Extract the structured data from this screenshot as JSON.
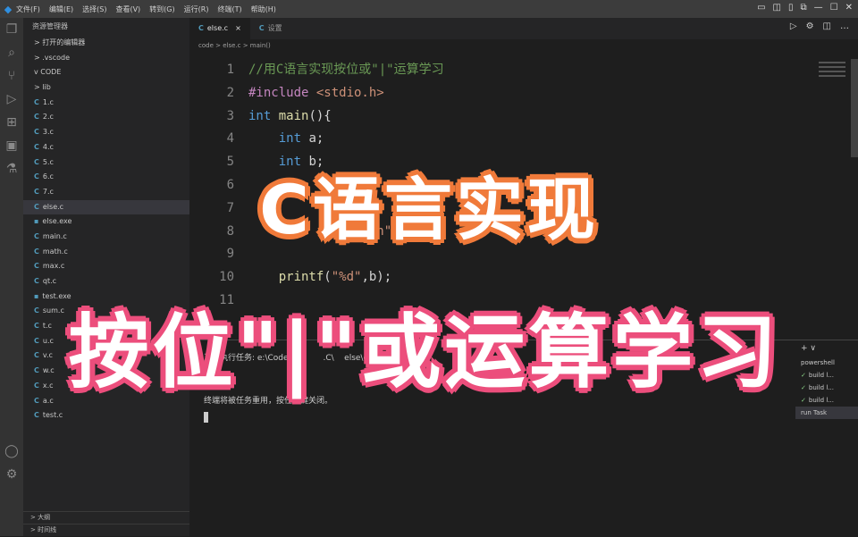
{
  "menu": [
    "文件(F)",
    "编辑(E)",
    "选择(S)",
    "查看(V)",
    "转到(G)",
    "运行(R)",
    "终端(T)",
    "帮助(H)"
  ],
  "window_controls": [
    "▭",
    "◫",
    "▯",
    "⧉",
    "—",
    "☐",
    "✕"
  ],
  "activity_icons": [
    "files-icon",
    "search-icon",
    "source-control-icon",
    "run-debug-icon",
    "extensions-icon",
    "remote-icon",
    "test-icon",
    "account-icon",
    "settings-icon"
  ],
  "sidebar": {
    "header": "资源管理器",
    "files": [
      {
        "label": "> 打开的编辑器",
        "type": "folder"
      },
      {
        "label": "> .vscode",
        "type": "folder"
      },
      {
        "label": "v CODE",
        "type": "folder"
      },
      {
        "label": "> lib",
        "type": "folder"
      },
      {
        "label": "1.c",
        "type": "c"
      },
      {
        "label": "2.c",
        "type": "c"
      },
      {
        "label": "3.c",
        "type": "c"
      },
      {
        "label": "4.c",
        "type": "c"
      },
      {
        "label": "5.c",
        "type": "c"
      },
      {
        "label": "6.c",
        "type": "c"
      },
      {
        "label": "7.c",
        "type": "c"
      },
      {
        "label": "else.c",
        "type": "c",
        "selected": true
      },
      {
        "label": "else.exe",
        "type": "exe"
      },
      {
        "label": "main.c",
        "type": "c"
      },
      {
        "label": "math.c",
        "type": "c"
      },
      {
        "label": "max.c",
        "type": "c"
      },
      {
        "label": "qt.c",
        "type": "c"
      },
      {
        "label": "test.exe",
        "type": "exe"
      },
      {
        "label": "sum.c",
        "type": "c"
      },
      {
        "label": "t.c",
        "type": "c"
      },
      {
        "label": "u.c",
        "type": "c"
      },
      {
        "label": "v.c",
        "type": "c"
      },
      {
        "label": "w.c",
        "type": "c"
      },
      {
        "label": "x.c",
        "type": "c"
      },
      {
        "label": "a.c",
        "type": "c"
      },
      {
        "label": "test.c",
        "type": "c"
      }
    ],
    "bottom": [
      "> 大纲",
      "> 时间线"
    ]
  },
  "tabs": [
    {
      "label": "else.c",
      "active": true
    },
    {
      "label": "设置",
      "active": false
    }
  ],
  "editor_tools": [
    "▷",
    "⚙",
    "◫",
    "…"
  ],
  "breadcrumb": "code > else.c > main()",
  "code_lines": [
    {
      "n": "1",
      "parts": [
        {
          "t": "//用C语言实现按位或\"|\"运算学习",
          "c": "cm"
        }
      ]
    },
    {
      "n": "2",
      "parts": [
        {
          "t": "#include ",
          "c": "pp"
        },
        {
          "t": "<stdio.h>",
          "c": "inc"
        }
      ]
    },
    {
      "n": "3",
      "parts": [
        {
          "t": "int ",
          "c": "kw"
        },
        {
          "t": "main",
          "c": "fn"
        },
        {
          "t": "(){",
          "c": "txt"
        }
      ]
    },
    {
      "n": "4",
      "parts": [
        {
          "t": "    int ",
          "c": "kw"
        },
        {
          "t": "a;",
          "c": "txt"
        }
      ]
    },
    {
      "n": "5",
      "parts": [
        {
          "t": "    int ",
          "c": "kw"
        },
        {
          "t": "b;",
          "c": "txt"
        }
      ]
    },
    {
      "n": "6",
      "parts": []
    },
    {
      "n": "7",
      "parts": []
    },
    {
      "n": "8",
      "parts": [
        {
          "t": "                \\n\"",
          "c": "str"
        }
      ]
    },
    {
      "n": "9",
      "parts": []
    },
    {
      "n": "10",
      "parts": [
        {
          "t": "    printf",
          "c": "fn"
        },
        {
          "t": "(",
          "c": "txt"
        },
        {
          "t": "\"%d\"",
          "c": "str"
        },
        {
          "t": ",b);",
          "c": "txt"
        }
      ]
    },
    {
      "n": "11",
      "parts": []
    }
  ],
  "terminal": {
    "lines": [
      "正在执行任务: e:\\Code_\\           .C\\    else\\else.exe",
      "",
      "终端将被任务重用，按任意键关闭。"
    ],
    "sessions_header": "+ ∨",
    "sessions": [
      {
        "label": "powershell",
        "check": false
      },
      {
        "label": "build l...",
        "check": true
      },
      {
        "label": "build l...",
        "check": true
      },
      {
        "label": "build l...",
        "check": true
      },
      {
        "label": "run Task",
        "check": false,
        "selected": true
      }
    ]
  },
  "overlay": {
    "line1": "C语言实现",
    "line2": "按位\"|\"或运算学习"
  }
}
